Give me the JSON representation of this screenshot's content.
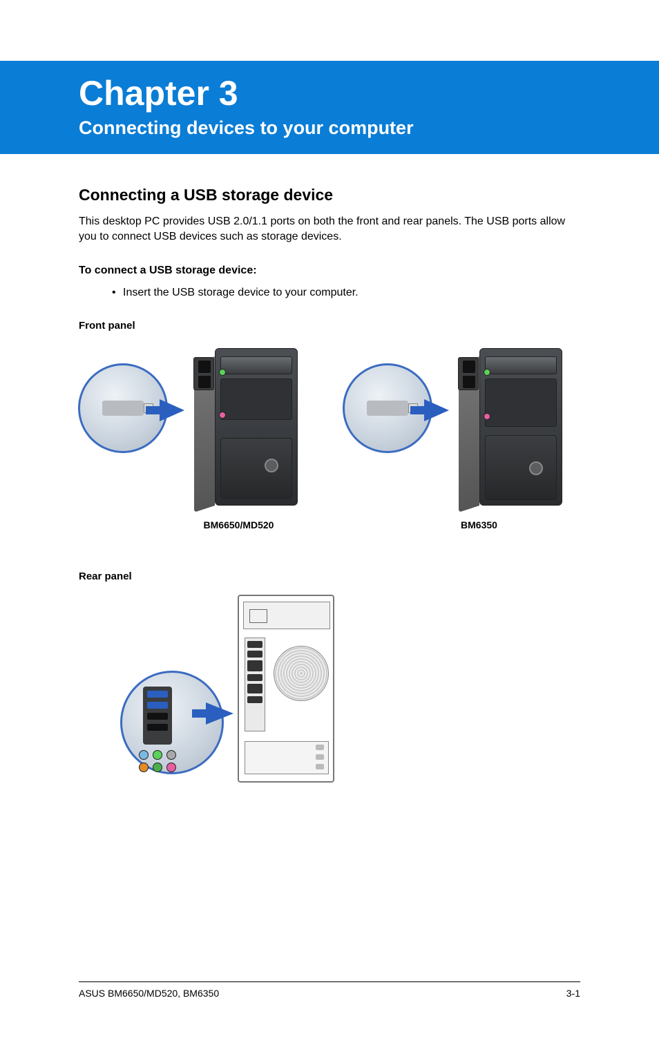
{
  "banner": {
    "chapter": "Chapter 3",
    "title": "Connecting devices to your computer"
  },
  "section": {
    "heading": "Connecting a USB storage device",
    "intro": "This desktop PC provides USB 2.0/1.1 ports on both the front and rear panels. The USB ports allow you to connect USB devices such as storage devices.",
    "step_heading": "To connect a USB storage device:",
    "step_bullet": "•",
    "step_text": "Insert the USB storage device to your computer."
  },
  "panels": {
    "front_label": "Front panel",
    "rear_label": "Rear panel"
  },
  "models": {
    "left": "BM6650/MD520",
    "right": "BM6350"
  },
  "footer": {
    "left": "ASUS BM6650/MD520, BM6350",
    "right": "3-1"
  }
}
